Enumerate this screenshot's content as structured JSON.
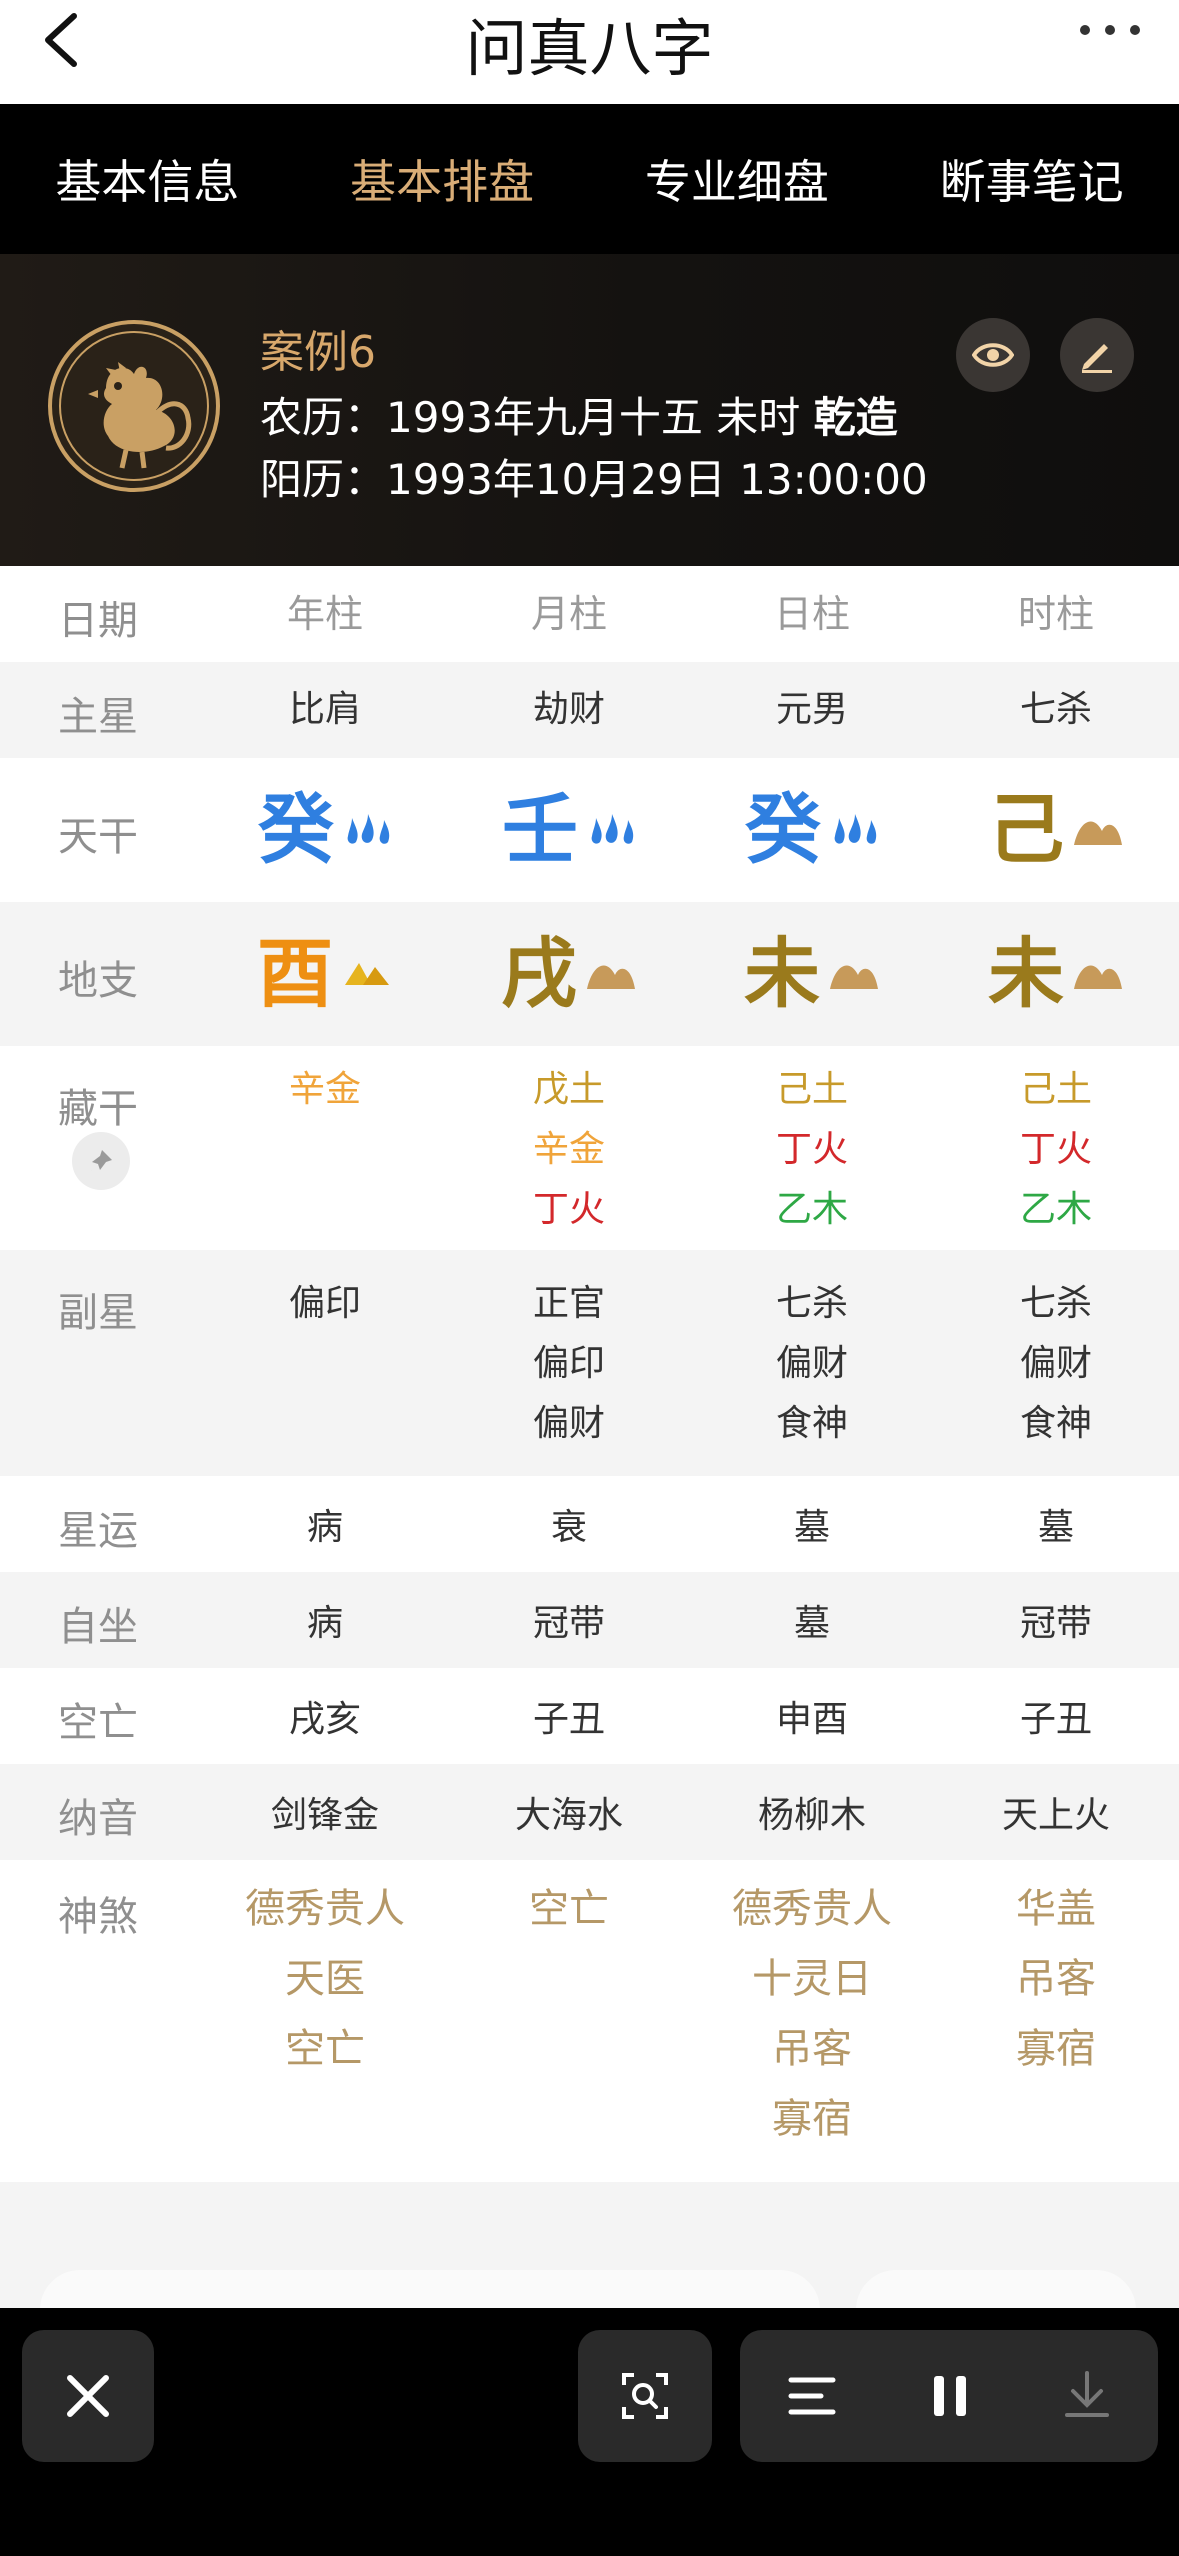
{
  "header": {
    "title": "问真八字",
    "back_icon": "chevron-left-icon",
    "more_icon": "more-dots-icon"
  },
  "tabs": [
    {
      "label": "基本信息"
    },
    {
      "label": "基本排盘",
      "active": true
    },
    {
      "label": "专业细盘"
    },
    {
      "label": "断事笔记"
    }
  ],
  "profile": {
    "avatar_icon": "rooster-zodiac-icon",
    "case_name": "案例6",
    "lunar_prefix": "农历：1993年九月十五 未时 ",
    "lunar_gender": "乾造",
    "solar": "阳历：1993年10月29日 13:00:00"
  },
  "table": {
    "labels": {
      "date": "日期",
      "main_star": "主星",
      "stem": "天干",
      "branch": "地支",
      "hidden_stem": "藏干",
      "sub_star": "副星",
      "star_luck": "星运",
      "self_sit": "自坐",
      "void": "空亡",
      "nayin": "纳音",
      "shensha": "神煞"
    },
    "columns": [
      "年柱",
      "月柱",
      "日柱",
      "时柱"
    ],
    "main_star": [
      "比肩",
      "劫财",
      "元男",
      "七杀"
    ],
    "stems": [
      {
        "char": "癸",
        "element": "water"
      },
      {
        "char": "壬",
        "element": "water"
      },
      {
        "char": "癸",
        "element": "water"
      },
      {
        "char": "己",
        "element": "earth"
      }
    ],
    "branches": [
      {
        "char": "酉",
        "element": "metal"
      },
      {
        "char": "戌",
        "element": "earth"
      },
      {
        "char": "未",
        "element": "earth"
      },
      {
        "char": "未",
        "element": "earth"
      }
    ],
    "hidden_stems": [
      [
        {
          "t": "辛金",
          "c": "lorange"
        }
      ],
      [
        {
          "t": "戊土",
          "c": "gold"
        },
        {
          "t": "辛金",
          "c": "lorange"
        },
        {
          "t": "丁火",
          "c": "red"
        }
      ],
      [
        {
          "t": "己土",
          "c": "gold"
        },
        {
          "t": "丁火",
          "c": "red"
        },
        {
          "t": "乙木",
          "c": "green"
        }
      ],
      [
        {
          "t": "己土",
          "c": "gold"
        },
        {
          "t": "丁火",
          "c": "red"
        },
        {
          "t": "乙木",
          "c": "green"
        }
      ]
    ],
    "sub_stars": [
      [
        "偏印"
      ],
      [
        "正官",
        "偏印",
        "偏财"
      ],
      [
        "七杀",
        "偏财",
        "食神"
      ],
      [
        "七杀",
        "偏财",
        "食神"
      ]
    ],
    "star_luck": [
      "病",
      "衰",
      "墓",
      "墓"
    ],
    "self_sit": [
      "病",
      "冠带",
      "墓",
      "冠带"
    ],
    "void": [
      "戌亥",
      "子丑",
      "申酉",
      "子丑"
    ],
    "nayin": [
      "剑锋金",
      "大海水",
      "杨柳木",
      "天上火"
    ],
    "shensha": [
      [
        "德秀贵人",
        "天医",
        "空亡"
      ],
      [
        "空亡"
      ],
      [
        "德秀贵人",
        "十灵日",
        "吊客",
        "寡宿"
      ],
      [
        "华盖",
        "吊客",
        "寡宿"
      ]
    ]
  },
  "colors": {
    "accent": "#d9ad77",
    "water": "#2f7fe0",
    "metal": "#ee8f12",
    "earth": "#9a7a1c"
  }
}
